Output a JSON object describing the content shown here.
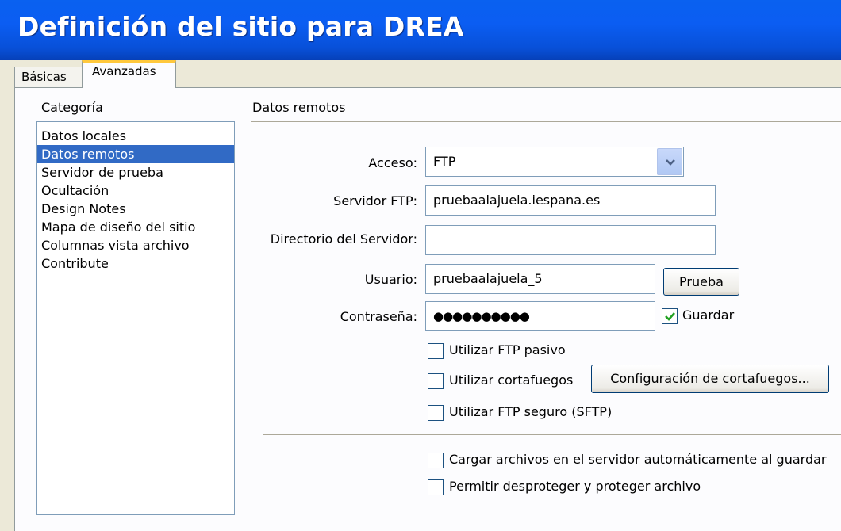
{
  "window": {
    "title": "Definición del sitio para DREA"
  },
  "tabs": [
    {
      "label": "Básicas",
      "active": false
    },
    {
      "label": "Avanzadas",
      "active": true
    }
  ],
  "category": {
    "header": "Categoría",
    "items": [
      {
        "label": "Datos locales",
        "selected": false
      },
      {
        "label": "Datos remotos",
        "selected": true
      },
      {
        "label": "Servidor de prueba",
        "selected": false
      },
      {
        "label": "Ocultación",
        "selected": false
      },
      {
        "label": "Design Notes",
        "selected": false
      },
      {
        "label": "Mapa de diseño del sitio",
        "selected": false
      },
      {
        "label": "Columnas vista archivo",
        "selected": false
      },
      {
        "label": "Contribute",
        "selected": false
      }
    ]
  },
  "section": {
    "title": "Datos remotos"
  },
  "form": {
    "access": {
      "label": "Acceso:",
      "value": "FTP"
    },
    "ftp_server": {
      "label": "Servidor FTP:",
      "value": "pruebaalajuela.iespana.es"
    },
    "server_dir": {
      "label": "Directorio del Servidor:",
      "value": ""
    },
    "user": {
      "label": "Usuario:",
      "value": "pruebaalajuela_5"
    },
    "password": {
      "label": "Contraseña:",
      "value": "●●●●●●●●●●"
    },
    "test_button": "Prueba",
    "save_password": {
      "label": "Guardar",
      "checked": true
    },
    "passive_ftp": {
      "label": "Utilizar FTP pasivo",
      "checked": false
    },
    "firewall": {
      "label": "Utilizar cortafuegos",
      "checked": false
    },
    "firewall_settings_button": "Configuración de cortafuegos...",
    "secure_ftp": {
      "label": "Utilizar FTP seguro (SFTP)",
      "checked": false
    },
    "auto_upload": {
      "label": "Cargar archivos en el servidor automáticamente al guardar",
      "checked": false
    },
    "check_in_out": {
      "label": "Permitir desproteger y proteger archivo",
      "checked": false
    }
  },
  "colors": {
    "titlebar": "#0b5df2",
    "selection": "#316ac5",
    "checkmark": "#21a121"
  },
  "icons": {
    "dropdown": "chevron-down-icon",
    "check": "checkmark-icon"
  }
}
